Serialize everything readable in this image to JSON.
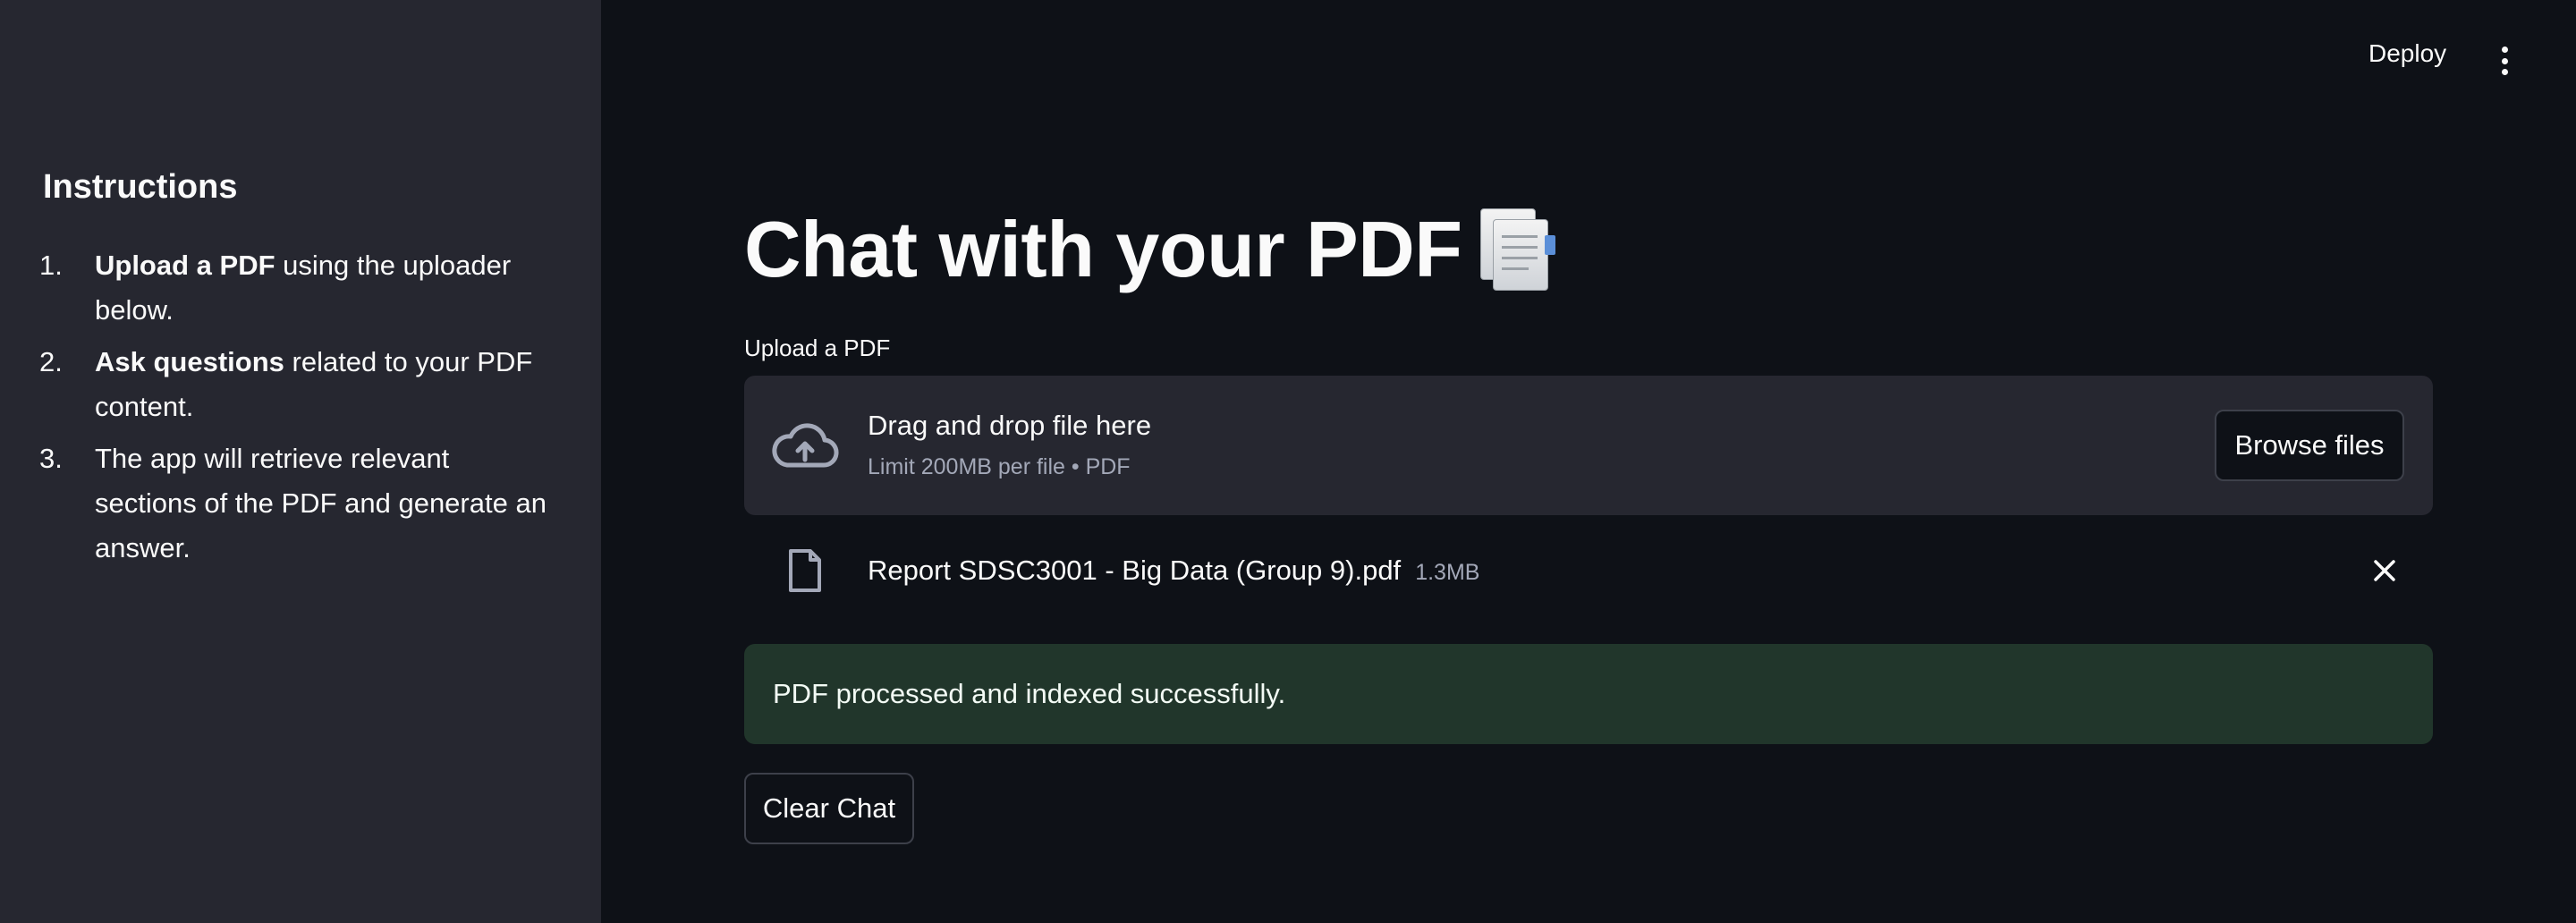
{
  "header": {
    "deploy_label": "Deploy",
    "menu_icon": "kebab-menu-icon"
  },
  "sidebar": {
    "title": "Instructions",
    "items": [
      {
        "num": "1.",
        "bold": "Upload a PDF",
        "rest": " using the uploader below."
      },
      {
        "num": "2.",
        "bold": "Ask questions",
        "rest": " related to your PDF content."
      },
      {
        "num": "3.",
        "bold": "",
        "rest": "The app will retrieve relevant sections of the PDF and generate an answer."
      }
    ]
  },
  "main": {
    "title": "Chat with your PDF",
    "title_icon": "page-facing-up-emoji",
    "uploader": {
      "label": "Upload a PDF",
      "drop_text": "Drag and drop file here",
      "limit_text": "Limit 200MB per file • PDF",
      "browse_label": "Browse files",
      "icon": "cloud-upload-icon"
    },
    "file": {
      "name": "Report SDSC3001 - Big Data (Group 9).pdf",
      "size": "1.3MB",
      "icon": "file-icon",
      "remove_icon": "close-icon"
    },
    "success_message": "PDF processed and indexed successfully.",
    "clear_label": "Clear Chat"
  },
  "colors": {
    "background": "#0e1117",
    "sidebar": "#262730",
    "success_bg": "#21362b",
    "text": "#fafafa",
    "muted": "#a3a8b8"
  }
}
